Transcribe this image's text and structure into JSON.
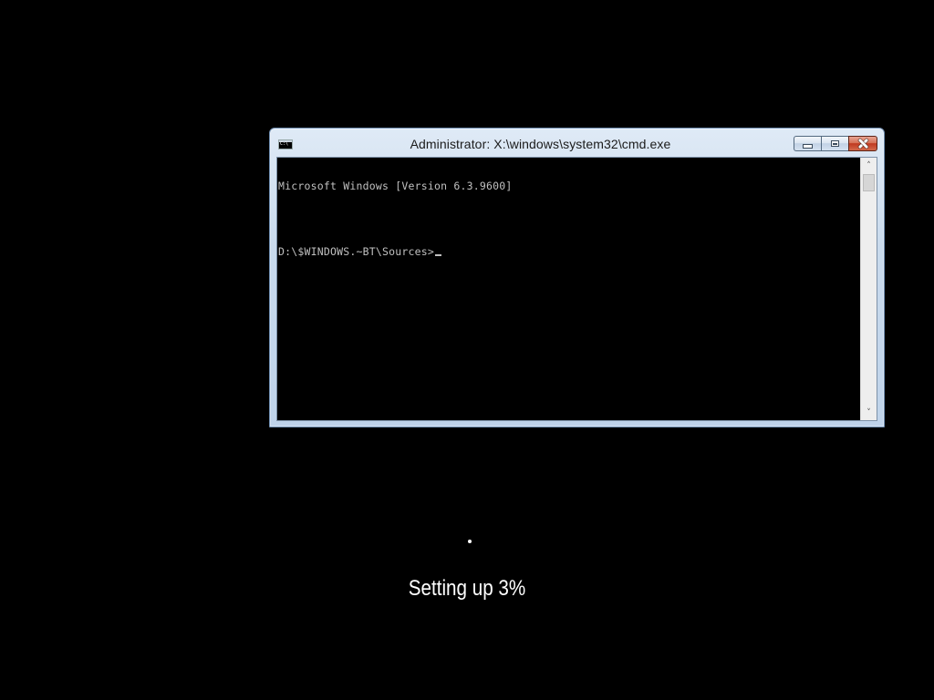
{
  "window": {
    "title": "Administrator: X:\\windows\\system32\\cmd.exe",
    "icon": "cmd-icon",
    "buttons": {
      "minimize": "minimize-icon",
      "maximize": "maximize-icon",
      "close": "close-icon"
    }
  },
  "console": {
    "lines": [
      "Microsoft Windows [Version 6.3.9600]",
      "",
      "D:\\$WINDOWS.~BT\\Sources>"
    ],
    "cursor": "_",
    "scrollbar": {
      "up_arrow": "˄",
      "down_arrow": "˅"
    }
  },
  "setup": {
    "status_text": "Setting up 3%",
    "progress_percent": 3
  },
  "colors": {
    "background": "#000000",
    "console_text": "#c0c0c0",
    "status_text": "#ffffff",
    "close_button": "#c7452b",
    "window_frame": "#c9daec"
  }
}
